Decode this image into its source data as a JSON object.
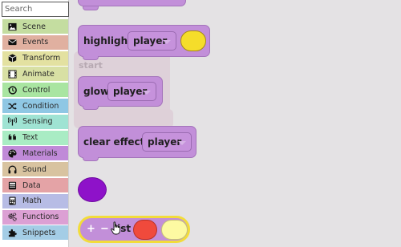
{
  "sidebar": {
    "search_placeholder": "Search",
    "categories": [
      {
        "label": "Scene",
        "icon": "image-icon",
        "color": "#c4dda0"
      },
      {
        "label": "Events",
        "icon": "envelope-icon",
        "color": "#e0b0a0"
      },
      {
        "label": "Transform",
        "icon": "cube-icon",
        "color": "#e3e1a1"
      },
      {
        "label": "Animate",
        "icon": "film-icon",
        "color": "#d8e0a4"
      },
      {
        "label": "Control",
        "icon": "history-icon",
        "color": "#a9e5a1"
      },
      {
        "label": "Condition",
        "icon": "shuffle-icon",
        "color": "#8fc7e4"
      },
      {
        "label": "Sensing",
        "icon": "antenna-icon",
        "color": "#9fe3d3"
      },
      {
        "label": "Text",
        "icon": "quote-icon",
        "color": "#a9ecc4"
      },
      {
        "label": "Materials",
        "icon": "palette-icon",
        "color": "#c08ad8"
      },
      {
        "label": "Sound",
        "icon": "headphones-icon",
        "color": "#d8c3a0"
      },
      {
        "label": "Data",
        "icon": "database-icon",
        "color": "#e4a3a6"
      },
      {
        "label": "Math",
        "icon": "calculator-icon",
        "color": "#b7bce5"
      },
      {
        "label": "Functions",
        "icon": "cogs-icon",
        "color": "#dca0d4"
      },
      {
        "label": "Snippets",
        "icon": "puzzle-icon",
        "color": "#a4cde6"
      }
    ]
  },
  "workspace": {
    "highlight_label": "highlight",
    "highlight_target": "player",
    "highlight_color": "#f5dd2a",
    "ghost_label": "start",
    "glow_label": "glow",
    "glow_target": "player",
    "clear_label": "clear effects",
    "clear_target": "player",
    "material_color": "#8e12c9",
    "list_plus": "+",
    "list_minus": "−",
    "list_label": "list",
    "list_item1_color": "#f04a3c",
    "list_item2_color": "#fdfaa2"
  }
}
